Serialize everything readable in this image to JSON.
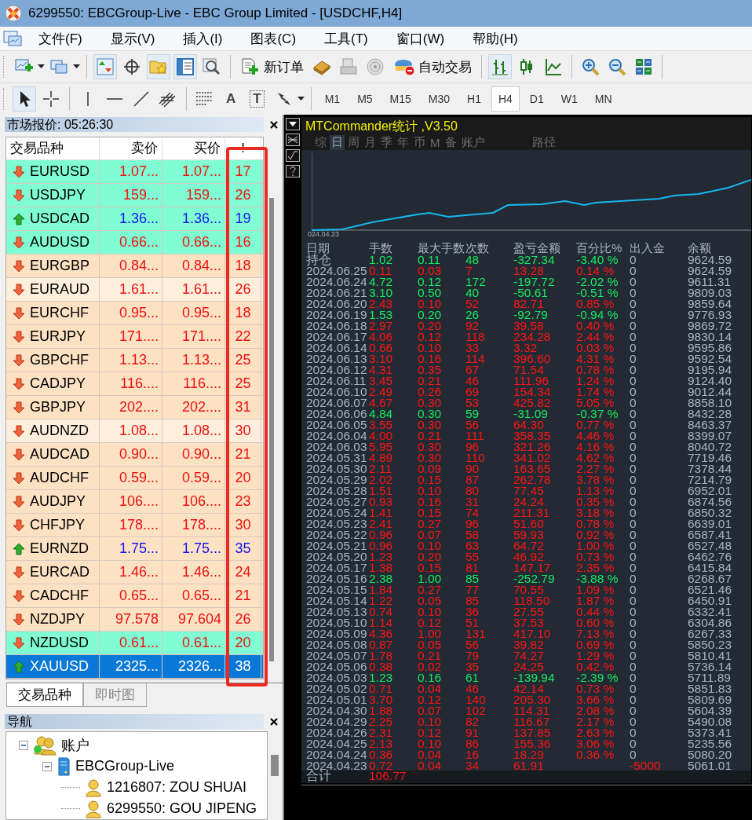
{
  "window": {
    "title": "6299550: EBCGroup-Live - EBC Group Limited - [USDCHF,H4]"
  },
  "menu": [
    "文件(F)",
    "显示(V)",
    "插入(I)",
    "图表(C)",
    "工具(T)",
    "窗口(W)",
    "帮助(H)"
  ],
  "toolbar": {
    "new_order": "新订单",
    "autotrading": "自动交易"
  },
  "drawing_tools": [
    {
      "kind": "text",
      "label": "A"
    },
    {
      "kind": "label",
      "label": "T"
    }
  ],
  "timeframes": [
    {
      "label": "M1",
      "selected": false
    },
    {
      "label": "M5",
      "selected": false
    },
    {
      "label": "M15",
      "selected": false
    },
    {
      "label": "M30",
      "selected": false
    },
    {
      "label": "H1",
      "selected": false
    },
    {
      "label": "H4",
      "selected": true
    },
    {
      "label": "D1",
      "selected": false
    },
    {
      "label": "W1",
      "selected": false
    },
    {
      "label": "MN",
      "selected": false
    }
  ],
  "market_watch": {
    "title": "市场报价: 05:26:30",
    "columns": [
      "交易品种",
      "卖价",
      "买价",
      "!"
    ],
    "rows": [
      {
        "symbol": "EURUSD",
        "bid": "1.07...",
        "ask": "1.07...",
        "spread": "17",
        "rising": false,
        "color": "#80fdd2",
        "selected": false
      },
      {
        "symbol": "USDJPY",
        "bid": "159...",
        "ask": "159...",
        "spread": "26",
        "rising": false,
        "color": "#80fdd2",
        "selected": false
      },
      {
        "symbol": "USDCAD",
        "bid": "1.36...",
        "ask": "1.36...",
        "spread": "19",
        "rising": true,
        "color": "#80fdd2",
        "selected": false
      },
      {
        "symbol": "AUDUSD",
        "bid": "0.66...",
        "ask": "0.66...",
        "spread": "16",
        "rising": false,
        "color": "#80fdd2",
        "selected": false
      },
      {
        "symbol": "EURGBP",
        "bid": "0.84...",
        "ask": "0.84...",
        "spread": "18",
        "rising": false,
        "color": "#fde1c3",
        "selected": false
      },
      {
        "symbol": "EURAUD",
        "bid": "1.61...",
        "ask": "1.61...",
        "spread": "26",
        "rising": false,
        "color": "#feefdc",
        "selected": false
      },
      {
        "symbol": "EURCHF",
        "bid": "0.95...",
        "ask": "0.95...",
        "spread": "18",
        "rising": false,
        "color": "#fde1c3",
        "selected": false
      },
      {
        "symbol": "EURJPY",
        "bid": "171....",
        "ask": "171....",
        "spread": "22",
        "rising": false,
        "color": "#fde1c3",
        "selected": false
      },
      {
        "symbol": "GBPCHF",
        "bid": "1.13...",
        "ask": "1.13...",
        "spread": "25",
        "rising": false,
        "color": "#fde1c3",
        "selected": false
      },
      {
        "symbol": "CADJPY",
        "bid": "116....",
        "ask": "116....",
        "spread": "25",
        "rising": false,
        "color": "#fde1c3",
        "selected": false
      },
      {
        "symbol": "GBPJPY",
        "bid": "202....",
        "ask": "202....",
        "spread": "31",
        "rising": false,
        "color": "#fde1c3",
        "selected": false
      },
      {
        "symbol": "AUDNZD",
        "bid": "1.08...",
        "ask": "1.08...",
        "spread": "30",
        "rising": false,
        "color": "#feefdc",
        "selected": false
      },
      {
        "symbol": "AUDCAD",
        "bid": "0.90...",
        "ask": "0.90...",
        "spread": "21",
        "rising": false,
        "color": "#fde1c3",
        "selected": false
      },
      {
        "symbol": "AUDCHF",
        "bid": "0.59...",
        "ask": "0.59...",
        "spread": "20",
        "rising": false,
        "color": "#fde1c3",
        "selected": false
      },
      {
        "symbol": "AUDJPY",
        "bid": "106....",
        "ask": "106....",
        "spread": "23",
        "rising": false,
        "color": "#fde1c3",
        "selected": false
      },
      {
        "symbol": "CHFJPY",
        "bid": "178....",
        "ask": "178....",
        "spread": "30",
        "rising": false,
        "color": "#fde1c3",
        "selected": false
      },
      {
        "symbol": "EURNZD",
        "bid": "1.75...",
        "ask": "1.75...",
        "spread": "35",
        "rising": true,
        "color": "#fde1c3",
        "selected": false
      },
      {
        "symbol": "EURCAD",
        "bid": "1.46...",
        "ask": "1.46...",
        "spread": "24",
        "rising": false,
        "color": "#fde1c3",
        "selected": false
      },
      {
        "symbol": "CADCHF",
        "bid": "0.65...",
        "ask": "0.65...",
        "spread": "21",
        "rising": false,
        "color": "#fde1c3",
        "selected": false
      },
      {
        "symbol": "NZDJPY",
        "bid": "97.578",
        "ask": "97.604",
        "spread": "26",
        "rising": false,
        "color": "#fde1c3",
        "selected": false
      },
      {
        "symbol": "NZDUSD",
        "bid": "0.61...",
        "ask": "0.61...",
        "spread": "20",
        "rising": false,
        "color": "#80fdd2",
        "selected": false
      },
      {
        "symbol": "XAUUSD",
        "bid": "2325...",
        "ask": "2326...",
        "spread": "38",
        "rising": true,
        "selected": true
      }
    ],
    "tabs": [
      {
        "label": "交易品种",
        "selected": true
      },
      {
        "label": "即时图",
        "selected": false
      }
    ]
  },
  "navigator": {
    "title": "导航",
    "tree": [
      {
        "label": "账户",
        "kind": "accounts",
        "expanded": true,
        "children": [
          {
            "label": "EBCGroup-Live",
            "kind": "server",
            "expanded": true,
            "children": [
              {
                "label": "1216807: ZOU SHUAI",
                "kind": "account"
              },
              {
                "label": "6299550: GOU JIPENG",
                "kind": "account"
              }
            ]
          }
        ]
      }
    ]
  },
  "stats_panel": {
    "title": "MTCommander统计 ,V3.50",
    "tabs": [
      {
        "label": "综",
        "selected": false
      },
      {
        "label": "日",
        "selected": true
      },
      {
        "label": "周",
        "selected": false
      },
      {
        "label": "月",
        "selected": false
      },
      {
        "label": "季",
        "selected": false
      },
      {
        "label": "年",
        "selected": false
      },
      {
        "label": "币",
        "selected": false
      },
      {
        "label": "M",
        "selected": false
      },
      {
        "label": "备",
        "selected": false
      },
      {
        "label": "账户",
        "selected": false
      },
      {
        "label": "路径",
        "selected": false
      }
    ],
    "chart_start_label": "024.04.23",
    "columns": [
      "日期",
      "手数",
      "最大手数",
      "次数",
      "盈亏金额",
      "百分比%",
      "出入金",
      "余额"
    ],
    "rows": [
      {
        "period": "持仓",
        "lots": "1.02",
        "max_lots": "0.11",
        "count": "48",
        "pnl": "-327.34",
        "pct": "-3.40 %",
        "deposit": "0",
        "balance": "9624.59",
        "loss": true
      },
      {
        "period": "2024.06.25",
        "lots": "0.11",
        "max_lots": "0.03",
        "count": "7",
        "pnl": "13.28",
        "pct": "0.14 %",
        "deposit": "0",
        "balance": "9624.59",
        "loss": false
      },
      {
        "period": "2024.06.24",
        "lots": "4.72",
        "max_lots": "0.12",
        "count": "172",
        "pnl": "-197.72",
        "pct": "-2.02 %",
        "deposit": "0",
        "balance": "9611.31",
        "loss": true
      },
      {
        "period": "2024.06.21",
        "lots": "3.10",
        "max_lots": "0.50",
        "count": "40",
        "pnl": "-50.61",
        "pct": "-0.51 %",
        "deposit": "0",
        "balance": "9809.03",
        "loss": true
      },
      {
        "period": "2024.06.20",
        "lots": "2.43",
        "max_lots": "0.10",
        "count": "52",
        "pnl": "82.71",
        "pct": "0.85 %",
        "deposit": "0",
        "balance": "9859.64",
        "loss": false
      },
      {
        "period": "2024.06.19",
        "lots": "1.53",
        "max_lots": "0.20",
        "count": "26",
        "pnl": "-92.79",
        "pct": "-0.94 %",
        "deposit": "0",
        "balance": "9776.93",
        "loss": true
      },
      {
        "period": "2024.06.18",
        "lots": "2.97",
        "max_lots": "0.20",
        "count": "92",
        "pnl": "39.58",
        "pct": "0.40 %",
        "deposit": "0",
        "balance": "9869.72",
        "loss": false
      },
      {
        "period": "2024.06.17",
        "lots": "4.06",
        "max_lots": "0.12",
        "count": "118",
        "pnl": "234.28",
        "pct": "2.44 %",
        "deposit": "0",
        "balance": "9830.14",
        "loss": false
      },
      {
        "period": "2024.06.14",
        "lots": "0.66",
        "max_lots": "0.10",
        "count": "33",
        "pnl": "3.32",
        "pct": "0.03 %",
        "deposit": "0",
        "balance": "9595.86",
        "loss": false
      },
      {
        "period": "2024.06.13",
        "lots": "3.10",
        "max_lots": "0.16",
        "count": "114",
        "pnl": "396.60",
        "pct": "4.31 %",
        "deposit": "0",
        "balance": "9592.54",
        "loss": false
      },
      {
        "period": "2024.06.12",
        "lots": "4.31",
        "max_lots": "0.35",
        "count": "67",
        "pnl": "71.54",
        "pct": "0.78 %",
        "deposit": "0",
        "balance": "9195.94",
        "loss": false
      },
      {
        "period": "2024.06.11",
        "lots": "3.45",
        "max_lots": "0.21",
        "count": "46",
        "pnl": "111.96",
        "pct": "1.24 %",
        "deposit": "0",
        "balance": "9124.40",
        "loss": false
      },
      {
        "period": "2024.06.10",
        "lots": "2.49",
        "max_lots": "0.26",
        "count": "69",
        "pnl": "154.34",
        "pct": "1.74 %",
        "deposit": "0",
        "balance": "9012.44",
        "loss": false
      },
      {
        "period": "2024.06.07",
        "lots": "4.67",
        "max_lots": "0.30",
        "count": "53",
        "pnl": "425.82",
        "pct": "5.05 %",
        "deposit": "0",
        "balance": "8858.10",
        "loss": false
      },
      {
        "period": "2024.06.06",
        "lots": "4.84",
        "max_lots": "0.30",
        "count": "59",
        "pnl": "-31.09",
        "pct": "-0.37 %",
        "deposit": "0",
        "balance": "8432.28",
        "loss": true
      },
      {
        "period": "2024.06.05",
        "lots": "3.55",
        "max_lots": "0.30",
        "count": "56",
        "pnl": "64.30",
        "pct": "0.77 %",
        "deposit": "0",
        "balance": "8463.37",
        "loss": false
      },
      {
        "period": "2024.06.04",
        "lots": "4.00",
        "max_lots": "0.21",
        "count": "111",
        "pnl": "358.35",
        "pct": "4.46 %",
        "deposit": "0",
        "balance": "8399.07",
        "loss": false
      },
      {
        "period": "2024.06.03",
        "lots": "5.95",
        "max_lots": "0.30",
        "count": "96",
        "pnl": "321.26",
        "pct": "4.16 %",
        "deposit": "0",
        "balance": "8040.72",
        "loss": false
      },
      {
        "period": "2024.05.31",
        "lots": "4.89",
        "max_lots": "0.30",
        "count": "110",
        "pnl": "341.02",
        "pct": "4.62 %",
        "deposit": "0",
        "balance": "7719.46",
        "loss": false
      },
      {
        "period": "2024.05.30",
        "lots": "2.11",
        "max_lots": "0.09",
        "count": "90",
        "pnl": "163.65",
        "pct": "2.27 %",
        "deposit": "0",
        "balance": "7378.44",
        "loss": false
      },
      {
        "period": "2024.05.29",
        "lots": "2.02",
        "max_lots": "0.15",
        "count": "87",
        "pnl": "262.78",
        "pct": "3.78 %",
        "deposit": "0",
        "balance": "7214.79",
        "loss": false
      },
      {
        "period": "2024.05.28",
        "lots": "1.51",
        "max_lots": "0.10",
        "count": "80",
        "pnl": "77.45",
        "pct": "1.13 %",
        "deposit": "0",
        "balance": "6952.01",
        "loss": false
      },
      {
        "period": "2024.05.27",
        "lots": "0.93",
        "max_lots": "0.16",
        "count": "31",
        "pnl": "24.24",
        "pct": "0.35 %",
        "deposit": "0",
        "balance": "6874.56",
        "loss": false
      },
      {
        "period": "2024.05.24",
        "lots": "1.41",
        "max_lots": "0.15",
        "count": "74",
        "pnl": "211.31",
        "pct": "3.18 %",
        "deposit": "0",
        "balance": "6850.32",
        "loss": false
      },
      {
        "period": "2024.05.23",
        "lots": "2.41",
        "max_lots": "0.27",
        "count": "96",
        "pnl": "51.60",
        "pct": "0.78 %",
        "deposit": "0",
        "balance": "6639.01",
        "loss": false
      },
      {
        "period": "2024.05.22",
        "lots": "0.96",
        "max_lots": "0.07",
        "count": "58",
        "pnl": "59.93",
        "pct": "0.92 %",
        "deposit": "0",
        "balance": "6587.41",
        "loss": false
      },
      {
        "period": "2024.05.21",
        "lots": "0.96",
        "max_lots": "0.10",
        "count": "63",
        "pnl": "64.72",
        "pct": "1.00 %",
        "deposit": "0",
        "balance": "6527.48",
        "loss": false
      },
      {
        "period": "2024.05.20",
        "lots": "1.23",
        "max_lots": "0.20",
        "count": "55",
        "pnl": "46.92",
        "pct": "0.73 %",
        "deposit": "0",
        "balance": "6462.76",
        "loss": false
      },
      {
        "period": "2024.05.17",
        "lots": "1.38",
        "max_lots": "0.15",
        "count": "81",
        "pnl": "147.17",
        "pct": "2.35 %",
        "deposit": "0",
        "balance": "6415.84",
        "loss": false
      },
      {
        "period": "2024.05.16",
        "lots": "2.38",
        "max_lots": "1.00",
        "count": "85",
        "pnl": "-252.79",
        "pct": "-3.88 %",
        "deposit": "0",
        "balance": "6268.67",
        "loss": true
      },
      {
        "period": "2024.05.15",
        "lots": "1.84",
        "max_lots": "0.27",
        "count": "77",
        "pnl": "70.55",
        "pct": "1.09 %",
        "deposit": "0",
        "balance": "6521.46",
        "loss": false
      },
      {
        "period": "2024.05.14",
        "lots": "1.22",
        "max_lots": "0.05",
        "count": "85",
        "pnl": "118.50",
        "pct": "1.87 %",
        "deposit": "0",
        "balance": "6450.91",
        "loss": false
      },
      {
        "period": "2024.05.13",
        "lots": "0.74",
        "max_lots": "0.10",
        "count": "36",
        "pnl": "27.55",
        "pct": "0.44 %",
        "deposit": "0",
        "balance": "6332.41",
        "loss": false
      },
      {
        "period": "2024.05.10",
        "lots": "1.14",
        "max_lots": "0.12",
        "count": "51",
        "pnl": "37.53",
        "pct": "0.60 %",
        "deposit": "0",
        "balance": "6304.86",
        "loss": false
      },
      {
        "period": "2024.05.09",
        "lots": "4.36",
        "max_lots": "1.00",
        "count": "131",
        "pnl": "417.10",
        "pct": "7.13 %",
        "deposit": "0",
        "balance": "6267.33",
        "loss": false
      },
      {
        "period": "2024.05.08",
        "lots": "0.87",
        "max_lots": "0.05",
        "count": "56",
        "pnl": "39.82",
        "pct": "0.69 %",
        "deposit": "0",
        "balance": "5850.23",
        "loss": false
      },
      {
        "period": "2024.05.07",
        "lots": "1.78",
        "max_lots": "0.21",
        "count": "79",
        "pnl": "74.27",
        "pct": "1.29 %",
        "deposit": "0",
        "balance": "5810.41",
        "loss": false
      },
      {
        "period": "2024.05.06",
        "lots": "0.38",
        "max_lots": "0.02",
        "count": "35",
        "pnl": "24.25",
        "pct": "0.42 %",
        "deposit": "0",
        "balance": "5736.14",
        "loss": false
      },
      {
        "period": "2024.05.03",
        "lots": "1.23",
        "max_lots": "0.16",
        "count": "61",
        "pnl": "-139.94",
        "pct": "-2.39 %",
        "deposit": "0",
        "balance": "5711.89",
        "loss": true
      },
      {
        "period": "2024.05.02",
        "lots": "0.71",
        "max_lots": "0.04",
        "count": "46",
        "pnl": "42.14",
        "pct": "0.73 %",
        "deposit": "0",
        "balance": "5851.83",
        "loss": false
      },
      {
        "period": "2024.05.01",
        "lots": "3.70",
        "max_lots": "0.12",
        "count": "140",
        "pnl": "205.30",
        "pct": "3.66 %",
        "deposit": "0",
        "balance": "5809.69",
        "loss": false
      },
      {
        "period": "2024.04.30",
        "lots": "1.88",
        "max_lots": "0.07",
        "count": "102",
        "pnl": "114.31",
        "pct": "2.08 %",
        "deposit": "0",
        "balance": "5604.39",
        "loss": false
      },
      {
        "period": "2024.04.29",
        "lots": "2.25",
        "max_lots": "0.10",
        "count": "82",
        "pnl": "116.67",
        "pct": "2.17 %",
        "deposit": "0",
        "balance": "5490.08",
        "loss": false
      },
      {
        "period": "2024.04.26",
        "lots": "2.31",
        "max_lots": "0.12",
        "count": "91",
        "pnl": "137.85",
        "pct": "2.63 %",
        "deposit": "0",
        "balance": "5373.41",
        "loss": false
      },
      {
        "period": "2024.04.25",
        "lots": "2.13",
        "max_lots": "0.10",
        "count": "86",
        "pnl": "155.36",
        "pct": "3.06 %",
        "deposit": "0",
        "balance": "5235.56",
        "loss": false
      },
      {
        "period": "2024.04.24",
        "lots": "0.36",
        "max_lots": "0.04",
        "count": "16",
        "pnl": "18.29",
        "pct": "0.36 %",
        "deposit": "0",
        "balance": "5080.20",
        "loss": false
      },
      {
        "period": "2024.04.23",
        "lots": "0.72",
        "max_lots": "0.04",
        "count": "34",
        "pnl": "61.91",
        "deposit": "-5000",
        "balance": "5061.01",
        "loss": false,
        "withdrawal": true
      }
    ],
    "total": {
      "label": "合计",
      "lots": "106.77"
    }
  }
}
